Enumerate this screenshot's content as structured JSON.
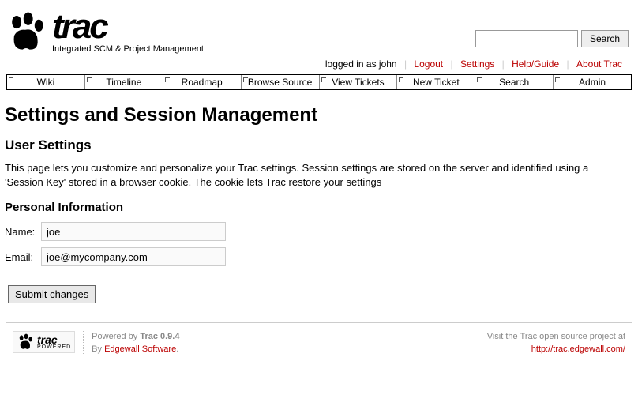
{
  "logo": {
    "tagline": "Integrated SCM & Project Management",
    "text": "trac"
  },
  "search": {
    "button": "Search"
  },
  "metanav": {
    "logged_in": "logged in as john",
    "logout": "Logout",
    "settings": "Settings",
    "help": "Help/Guide",
    "about": "About Trac"
  },
  "mainnav": [
    "Wiki",
    "Timeline",
    "Roadmap",
    "Browse Source",
    "View Tickets",
    "New Ticket",
    "Search",
    "Admin"
  ],
  "page": {
    "title": "Settings and Session Management",
    "h2": "User Settings",
    "desc": "This page lets you customize and personalize your Trac settings. Session settings are stored on the server and identified using a 'Session Key' stored in a browser cookie. The cookie lets Trac restore your settings",
    "h3": "Personal Information",
    "name_label": "Name:",
    "name_value": "joe",
    "email_label": "Email:",
    "email_value": "joe@mycompany.com",
    "submit": "Submit changes"
  },
  "footer": {
    "powered": "Powered by ",
    "trac_ver": "Trac 0.9.4",
    "by": "By ",
    "edgewall": "Edgewall Software",
    "period": ".",
    "visit": "Visit the Trac open source project at",
    "url": "http://trac.edgewall.com/",
    "logo_text": "trac",
    "logo_sub": "POWERED"
  }
}
